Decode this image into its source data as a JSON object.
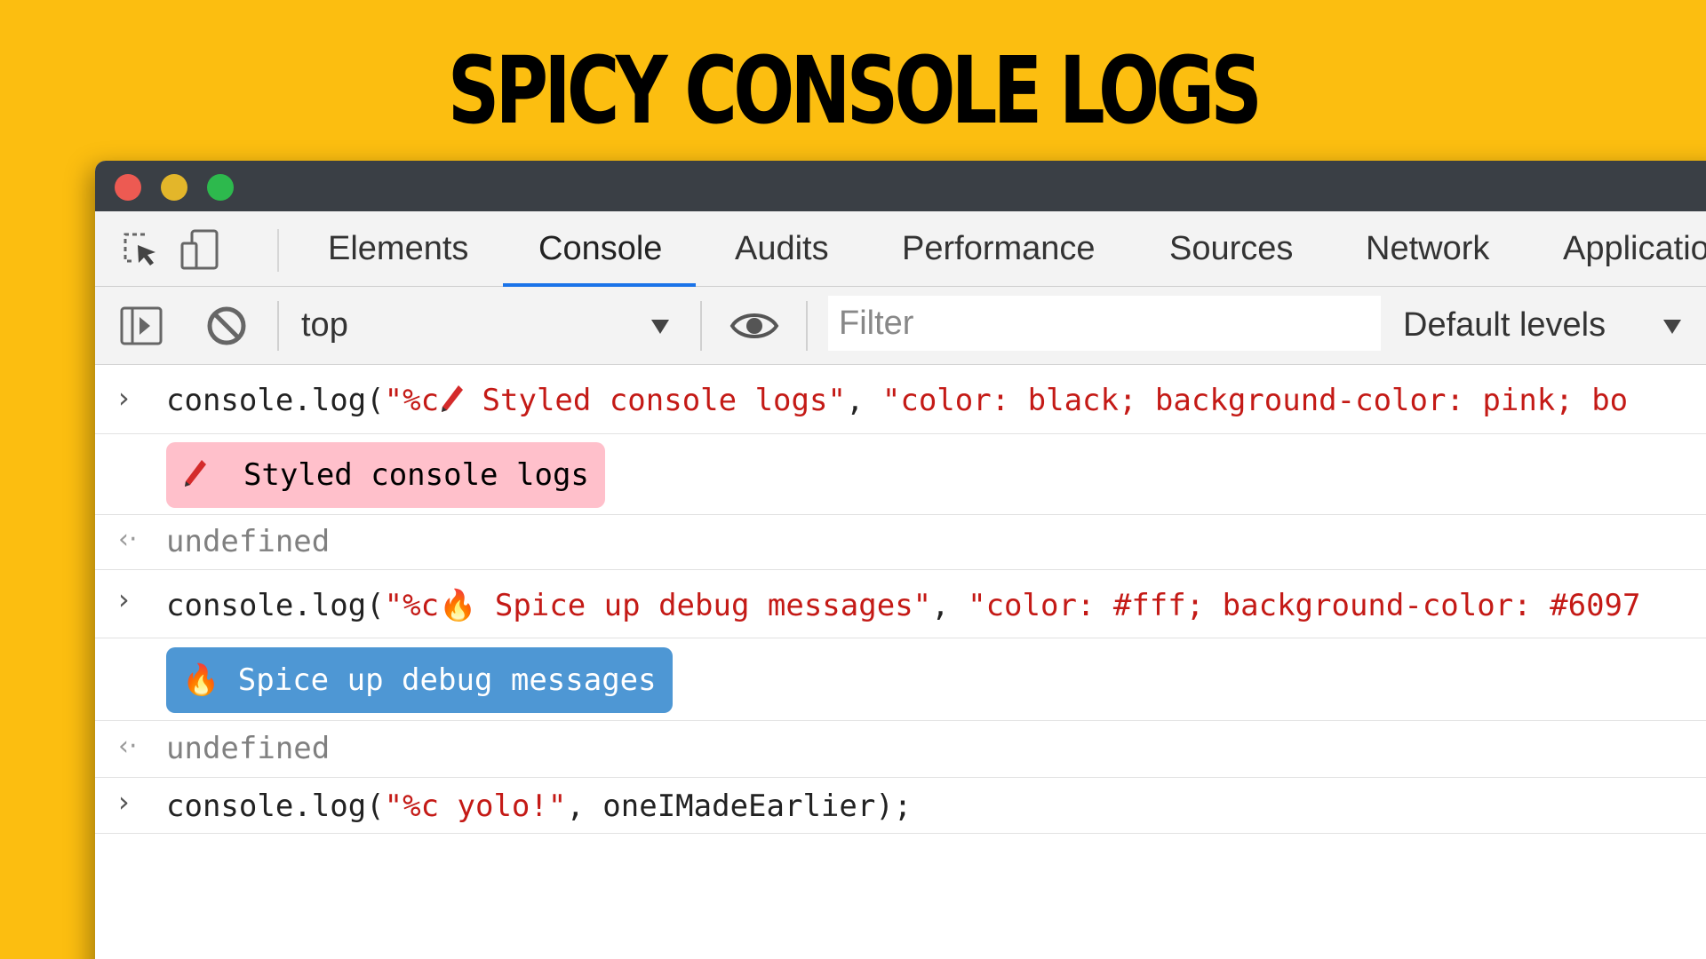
{
  "headline": "SPICY CONSOLE LOGS",
  "tabs": [
    "Elements",
    "Console",
    "Audits",
    "Performance",
    "Sources",
    "Network",
    "Applicatio"
  ],
  "active_tab": "Console",
  "toolbar": {
    "context": "top",
    "filter_placeholder": "Filter",
    "levels": "Default levels"
  },
  "console": {
    "line1": {
      "prefix": "console.log(",
      "str1": "\"%c",
      "str1b": " Styled console logs\"",
      "comma": ", ",
      "str2": "\"color: black; background-color: pink; bo"
    },
    "badge1": "Styled console logs",
    "result1": "undefined",
    "line2": {
      "prefix": "console.log(",
      "str1": "\"%c🔥 Spice up debug messages\"",
      "comma": ", ",
      "str2": "\"color: #fff; background-color: #6097"
    },
    "badge2": "🔥  Spice up debug messages",
    "result2": "undefined",
    "line3": {
      "prefix": "console.log(",
      "str1": "\"%c yolo!\"",
      "suffix": ", oneIMadeEarlier);"
    }
  },
  "colors": {
    "background": "#FCBE10",
    "titlebar": "#3A3F45",
    "active_tab_underline": "#1A73E8",
    "string": "#C41A16",
    "badge_pink": "#FFC0CB",
    "badge_blue": "#4E97D4"
  }
}
